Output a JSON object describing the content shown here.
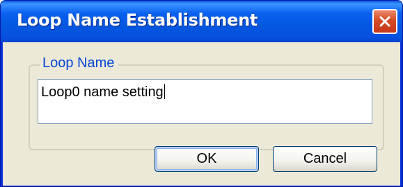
{
  "window": {
    "title": "Loop Name Establishment"
  },
  "group": {
    "label": "Loop Name"
  },
  "input": {
    "value": "Loop0 name setting"
  },
  "buttons": {
    "ok_label": "OK",
    "cancel_label": "Cancel"
  },
  "colors": {
    "titlebar": "#0a5ae6",
    "close_button": "#d54b24",
    "client_background": "#ece9d8",
    "group_label": "#0046d5"
  },
  "icons": {
    "close": "close-icon"
  }
}
